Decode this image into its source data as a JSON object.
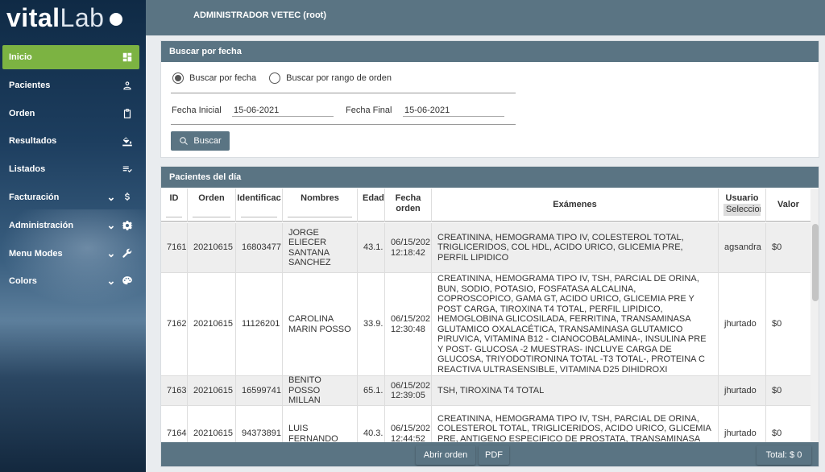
{
  "logo": {
    "part1": "vital",
    "part2": "Lab"
  },
  "sidebar": {
    "items": [
      {
        "label": "Inicio",
        "icon": "dashboard-icon",
        "active": true,
        "expandable": false
      },
      {
        "label": "Pacientes",
        "icon": "person-icon",
        "active": false,
        "expandable": false
      },
      {
        "label": "Orden",
        "icon": "clipboard-icon",
        "active": false,
        "expandable": false
      },
      {
        "label": "Resultados",
        "icon": "paint-bucket-icon",
        "active": false,
        "expandable": false
      },
      {
        "label": "Listados",
        "icon": "playlist-check-icon",
        "active": false,
        "expandable": false
      },
      {
        "label": "Facturación",
        "icon": "dollar-icon",
        "active": false,
        "expandable": true
      },
      {
        "label": "Administración",
        "icon": "gear-icon",
        "active": false,
        "expandable": true
      },
      {
        "label": "Menu Modes",
        "icon": "wrench-icon",
        "active": false,
        "expandable": true
      },
      {
        "label": "Colors",
        "icon": "palette-icon",
        "active": false,
        "expandable": true
      }
    ]
  },
  "topbar": {
    "user": "ADMINISTRADOR VETEC (root)"
  },
  "search": {
    "title": "Buscar por fecha",
    "option1": "Buscar por fecha",
    "option2": "Buscar por rango de orden",
    "selected": "option1",
    "fecha_inicial_label": "Fecha Inicial",
    "fecha_inicial": "15-06-2021",
    "fecha_final_label": "Fecha Final",
    "fecha_final": "15-06-2021",
    "button": "Buscar"
  },
  "patients": {
    "title": "Pacientes del día",
    "columns": {
      "id": "ID",
      "orden": "Orden",
      "identificacion": "Identificac",
      "nombres": "Nombres",
      "edad": "Edad",
      "fecha_orden": "Fecha\norden",
      "examenes": "Exámenes",
      "usuario": "Usuario",
      "usuario_select": "Seleccion",
      "valor": "Valor"
    },
    "rows": [
      {
        "id": "7161",
        "orden": "20210615",
        "identificacion": "16803477",
        "nombres": "JORGE\nELIECER\nSANTANA\nSANCHEZ",
        "edad": "43.1.",
        "fecha": "06/15/202\n12:18:42",
        "examenes": "CREATININA, HEMOGRAMA TIPO IV, COLESTEROL TOTAL, TRIGLICERIDOS, COL HDL, ACIDO URICO, GLICEMIA PRE, PERFIL LIPIDICO",
        "usuario": "agsandra",
        "valor": "$0"
      },
      {
        "id": "7162",
        "orden": "20210615",
        "identificacion": "11126201",
        "nombres": "CAROLINA\nMARIN POSSO",
        "edad": "33.9.",
        "fecha": "06/15/202\n12:30:48",
        "examenes": "CREATININA, HEMOGRAMA TIPO IV, TSH, PARCIAL DE ORINA, BUN, SODIO, POTASIO, FOSFATASA ALCALINA, COPROSCOPICO, GAMA GT, ACIDO URICO, GLICEMIA PRE Y POST CARGA, TIROXINA T4 TOTAL, PERFIL LIPIDICO, HEMOGLOBINA GLICOSILADA, FERRITINA, TRANSAMINASA GLUTAMICO OXALACÉTICA, TRANSAMINASA GLUTAMICO PIRUVICA, VITAMINA B12 - CIANOCOBALAMINA-, INSULINA PRE Y POST- GLUCOSA -2 MUESTRAS- INCLUYE CARGA DE GLUCOSA, TRIYODOTIRONINA TOTAL -T3 TOTAL-, PROTEINA C REACTIVA ULTRASENSIBLE, VITAMINA D25 DIHIDROXI",
        "usuario": "jhurtado",
        "valor": "$0"
      },
      {
        "id": "7163",
        "orden": "20210615",
        "identificacion": "16599741",
        "nombres": "BENITO POSSO\nMILLAN",
        "edad": "65.1.",
        "fecha": "06/15/202\n12:39:05",
        "examenes": "TSH, TIROXINA T4 TOTAL",
        "usuario": "jhurtado",
        "valor": "$0"
      },
      {
        "id": "7164",
        "orden": "20210615",
        "identificacion": "94373891",
        "nombres": "LUIS\nFERNANDO",
        "edad": "40.3.",
        "fecha": "06/15/202\n12:44:52",
        "examenes": "CREATININA, HEMOGRAMA TIPO IV, TSH, PARCIAL DE ORINA, COLESTEROL TOTAL, TRIGLICERIDOS, ACIDO URICO, GLICEMIA PRE, ANTIGENO ESPECIFICO DE PROSTATA, TRANSAMINASA GLUTAMICO",
        "usuario": "jhurtado",
        "valor": "$0"
      }
    ],
    "footer": {
      "abrir": "Abrir orden",
      "pdf": "PDF",
      "total": "Total: $ 0"
    }
  }
}
